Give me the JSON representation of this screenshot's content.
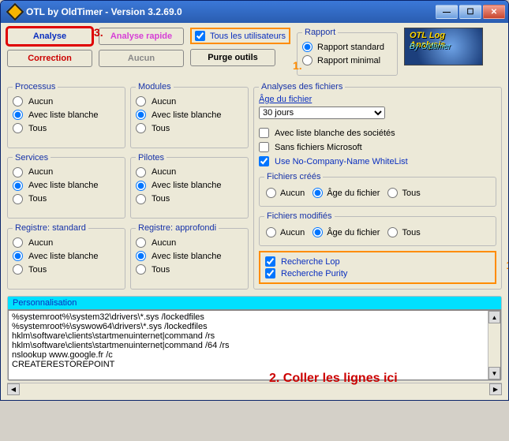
{
  "window": {
    "title": "OTL by OldTimer - Version 3.2.69.0"
  },
  "buttons": {
    "analyse": "Analyse",
    "analyse_rapide": "Analyse rapide",
    "correction": "Correction",
    "aucun": "Aucun",
    "purge": "Purge outils"
  },
  "checkboxes": {
    "tous_utilisateurs": "Tous les utilisateurs"
  },
  "rapport": {
    "legend": "Rapport",
    "standard": "Rapport standard",
    "minimal": "Rapport minimal"
  },
  "logo": {
    "line1": "OTL Log Analysis",
    "line2": "By Oldtimer"
  },
  "radiogroups": {
    "opt_aucun": "Aucun",
    "opt_liste": "Avec liste blanche",
    "opt_tous": "Tous"
  },
  "groups": {
    "processus": "Processus",
    "modules": "Modules",
    "services": "Services",
    "pilotes": "Pilotes",
    "registre_std": "Registre: standard",
    "registre_app": "Registre: approfondi"
  },
  "analyse_fichiers": {
    "legend": "Analyses des fichiers",
    "age_link": "Âge du fichier",
    "age_select": "30 jours",
    "societe": "Avec liste blanche des sociétés",
    "microsoft": "Sans fichiers Microsoft",
    "nocompany": "Use No-Company-Name WhiteList",
    "crees": "Fichiers créés",
    "modifies": "Fichiers modifiés",
    "r_aucun": "Aucun",
    "r_age": "Âge du fichier",
    "r_tous": "Tous",
    "lop": "Recherche Lop",
    "purity": "Recherche Purity"
  },
  "personnalisation": {
    "legend": "Personnalisation",
    "content": "%systemroot%\\system32\\drivers\\*.sys /lockedfiles\n%systemroot%\\syswow64\\drivers\\*.sys /lockedfiles\nhklm\\software\\clients\\startmenuinternet|command /rs\nhklm\\software\\clients\\startmenuinternet|command /64 /rs\nnslookup www.google.fr /c\nCREATERESTOREPOINT"
  },
  "annotations": {
    "a1": "1.",
    "a2": "2. Coller les lignes ici",
    "a3": "3."
  }
}
